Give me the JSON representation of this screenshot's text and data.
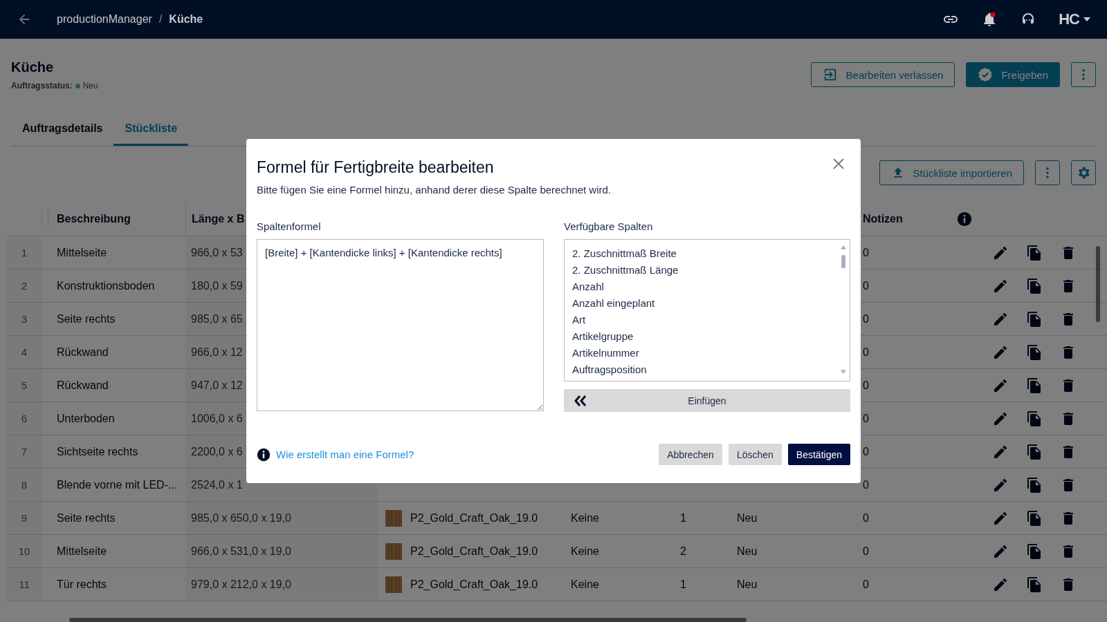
{
  "top_bar": {
    "breadcrumb": [
      {
        "label": "productionManager",
        "current": false
      },
      {
        "label": "Küche",
        "current": true
      }
    ],
    "separator": "/",
    "notifications_unread": true,
    "user_menu": "HC"
  },
  "page": {
    "title": "Küche",
    "status_label": "Auftragsstatus:",
    "status_value": "Neu"
  },
  "header_actions": [
    {
      "label": "Bearbeiten verlassen",
      "kind": "outline"
    },
    {
      "label": "Freigeben",
      "kind": "primary"
    }
  ],
  "tabs": [
    {
      "label": "Auftragsdetails",
      "selected": false
    },
    {
      "label": "Stückliste",
      "selected": true
    }
  ],
  "toolbar": {
    "import_label": "Stückliste importieren"
  },
  "table": {
    "columns": {
      "description": "Beschreibung",
      "dimensions": "Länge x B",
      "notes": "Notizen"
    },
    "rows": [
      {
        "index": "1",
        "description": "Mittelseite",
        "dimensions": "966,0 x 53",
        "notes": "0"
      },
      {
        "index": "2",
        "description": "Konstruktionsboden",
        "dimensions": "180,0 x 59",
        "notes": "0"
      },
      {
        "index": "3",
        "description": "Seite rechts",
        "dimensions": "985,0 x 65",
        "notes": "0"
      },
      {
        "index": "4",
        "description": "Rückwand",
        "dimensions": "966,0 x 12",
        "notes": "0"
      },
      {
        "index": "5",
        "description": "Rückwand",
        "dimensions": "947,0 x 12",
        "notes": "0"
      },
      {
        "index": "6",
        "description": "Unterboden",
        "dimensions": "1006,0 x 6",
        "notes": "0"
      },
      {
        "index": "7",
        "description": "Sichtseite rechts",
        "dimensions": "2200,0 x 6",
        "notes": "0"
      },
      {
        "index": "8",
        "description": "Blende vorne mit LED-...",
        "dimensions": "2524,0 x 1",
        "notes": "0"
      },
      {
        "index": "9",
        "description": "Seite rechts",
        "dimensions": "985,0 x 650,0 x 19,0",
        "material": "P2_Gold_Craft_Oak_19.0",
        "art": "Keine",
        "count": "1",
        "status": "Neu",
        "notes": "0"
      },
      {
        "index": "10",
        "description": "Mittelseite",
        "dimensions": "966,0 x 531,0 x 19,0",
        "material": "P2_Gold_Craft_Oak_19.0",
        "art": "Keine",
        "count": "2",
        "status": "Neu",
        "notes": "0"
      },
      {
        "index": "11",
        "description": "Tür rechts",
        "dimensions": "979,0 x 212,0 x 19,0",
        "material": "P2_Gold_Craft_Oak_19.0",
        "art": "Keine",
        "count": "1",
        "status": "Neu",
        "notes": "0"
      }
    ]
  },
  "dialog": {
    "title": "Formel für Fertigbreite bearbeiten",
    "subtitle": "Bitte fügen Sie eine Formel hinzu, anhand derer diese Spalte berechnet wird.",
    "formula_label": "Spaltenformel",
    "formula_value": "[Breite] + [Kantendicke links] + [Kantendicke rechts]",
    "columns_label": "Verfügbare Spalten",
    "available_columns": [
      {
        "label": "2. Zuschnittmaß Breite",
        "selected": false
      },
      {
        "label": "2. Zuschnittmaß Länge",
        "selected": false
      },
      {
        "label": "Anzahl",
        "selected": false
      },
      {
        "label": "Anzahl eingeplant",
        "selected": false
      },
      {
        "label": "Art",
        "selected": false
      },
      {
        "label": "Artikelgruppe",
        "selected": false
      },
      {
        "label": "Artikelnummer",
        "selected": false
      },
      {
        "label": "Auftragsposition",
        "selected": false
      }
    ],
    "insert_label": "Einfügen",
    "help_link": "Wie erstellt man eine Formel?",
    "buttons": [
      {
        "label": "Abbrechen",
        "kind": "secondary"
      },
      {
        "label": "Löschen",
        "kind": "secondary"
      },
      {
        "label": "Bestätigen",
        "kind": "primary"
      }
    ]
  }
}
